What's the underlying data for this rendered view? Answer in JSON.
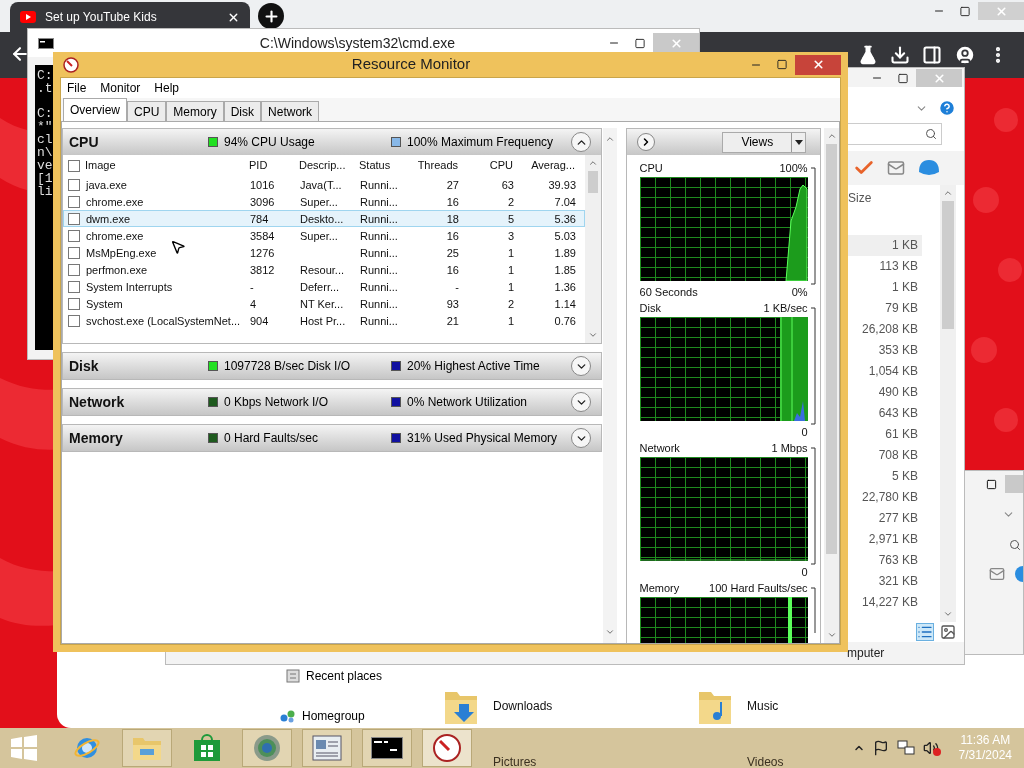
{
  "browser": {
    "tab": {
      "title": "Set up YouTube Kids"
    }
  },
  "cmd": {
    "title": "C:\\Windows\\system32\\cmd.exe",
    "blocks": [
      [
        "C:",
        ".t"
      ],
      [
        "C:",
        "*\"",
        "cl",
        "n\\",
        "ve",
        "[1",
        "li"
      ]
    ]
  },
  "resource_monitor": {
    "title": "Resource Monitor",
    "menu": [
      "File",
      "Monitor",
      "Help"
    ],
    "tabs": [
      {
        "label": "Overview",
        "selected": true
      },
      {
        "label": "CPU",
        "selected": false
      },
      {
        "label": "Memory",
        "selected": false
      },
      {
        "label": "Disk",
        "selected": false
      },
      {
        "label": "Network",
        "selected": false
      }
    ],
    "sections": [
      {
        "name": "CPU",
        "expanded": true,
        "stats": [
          {
            "text": "94% CPU Usage",
            "color": "#22e022"
          },
          {
            "text": "100% Maximum Frequency",
            "color": "#88b8e8"
          }
        ]
      },
      {
        "name": "Disk",
        "expanded": false,
        "stats": [
          {
            "text": "1097728 B/sec Disk I/O",
            "color": "#22e022"
          },
          {
            "text": "20% Highest Active Time",
            "color": "#1010a0"
          }
        ]
      },
      {
        "name": "Network",
        "expanded": false,
        "stats": [
          {
            "text": "0 Kbps Network I/O",
            "color": "#1e5a1e"
          },
          {
            "text": "0% Network Utilization",
            "color": "#1010a0"
          }
        ]
      },
      {
        "name": "Memory",
        "expanded": false,
        "stats": [
          {
            "text": "0 Hard Faults/sec",
            "color": "#1e5a1e"
          },
          {
            "text": "31% Used Physical Memory",
            "color": "#1010a0"
          }
        ]
      }
    ],
    "process_table": {
      "all_checked": false,
      "columns": [
        "Image",
        "PID",
        "Descrip...",
        "Status",
        "Threads",
        "CPU",
        "Averag..."
      ],
      "rows": [
        {
          "checked": false,
          "selected": false,
          "cells": [
            "java.exe",
            "1016",
            "Java(T...",
            "Runni...",
            "27",
            "63",
            "39.93"
          ]
        },
        {
          "checked": false,
          "selected": false,
          "cells": [
            "chrome.exe",
            "3096",
            "Super...",
            "Runni...",
            "16",
            "2",
            "7.04"
          ]
        },
        {
          "checked": false,
          "selected": true,
          "cells": [
            "dwm.exe",
            "784",
            "Deskto...",
            "Runni...",
            "18",
            "5",
            "5.36"
          ]
        },
        {
          "checked": false,
          "selected": false,
          "cells": [
            "chrome.exe",
            "3584",
            "Super...",
            "Runni...",
            "16",
            "3",
            "5.03"
          ]
        },
        {
          "checked": false,
          "selected": false,
          "cells": [
            "MsMpEng.exe",
            "1276",
            null,
            "Runni...",
            "25",
            "1",
            "1.89"
          ]
        },
        {
          "checked": false,
          "selected": false,
          "cells": [
            "perfmon.exe",
            "3812",
            "Resour...",
            "Runni...",
            "16",
            "1",
            "1.85"
          ]
        },
        {
          "checked": false,
          "selected": false,
          "cells": [
            "System Interrupts",
            "-",
            "Deferr...",
            "Runni...",
            "-",
            "1",
            "1.36"
          ]
        },
        {
          "checked": false,
          "selected": false,
          "cells": [
            "System",
            "4",
            "NT Ker...",
            "Runni...",
            "93",
            "2",
            "1.14"
          ]
        },
        {
          "checked": false,
          "selected": false,
          "cells": [
            "svchost.exe (LocalSystemNet...",
            "904",
            "Host Pr...",
            "Runni...",
            "21",
            "1",
            "0.76"
          ]
        }
      ]
    },
    "graph_panel": {
      "views_button": "Views",
      "graphs": [
        {
          "kind": "rise",
          "title": "CPU",
          "scale_max": "100%",
          "footer_left": "60 Seconds",
          "scale_min": "0%"
        },
        {
          "kind": "burst",
          "title": "Disk",
          "scale_max": "1 KB/sec",
          "scale_min": "0"
        },
        {
          "kind": "flat",
          "title": "Network",
          "scale_max": "1 Mbps",
          "scale_min": "0"
        },
        {
          "kind": "spike",
          "title": "Memory",
          "scale_max": "100 Hard Faults/sec"
        }
      ]
    }
  },
  "explorer": {
    "column": "Size",
    "sizes": [
      "1 KB",
      "113 KB",
      "1 KB",
      "79 KB",
      "26,208 KB",
      "353 KB",
      "1,054 KB",
      "490 KB",
      "643 KB",
      "61 KB",
      "708 KB",
      "5 KB",
      "22,780 KB",
      "277 KB",
      "2,971 KB",
      "763 KB",
      "321 KB",
      "14,227 KB"
    ],
    "status": "mputer"
  },
  "explorer_lower": {
    "nav": [
      {
        "label": "Recent places",
        "kind": "recent"
      },
      {
        "label": "Homegroup",
        "kind": "homegroup"
      }
    ],
    "folders": [
      {
        "label": "Downloads",
        "kind": "downloads"
      },
      {
        "label": "Music",
        "kind": "music"
      },
      {
        "label": "Pictures"
      },
      {
        "label": "Videos"
      }
    ]
  },
  "taskbar": {
    "apps": [
      {
        "kind": "ie",
        "running": false,
        "selected": false
      },
      {
        "kind": "explorer",
        "running": true,
        "selected": false
      },
      {
        "kind": "store",
        "running": false,
        "selected": false
      },
      {
        "kind": "chrome",
        "running": true,
        "selected": false
      },
      {
        "kind": "reader",
        "running": true,
        "selected": false
      },
      {
        "kind": "cmd",
        "running": true,
        "selected": false
      },
      {
        "kind": "resmon",
        "running": true,
        "selected": true
      }
    ],
    "clock": {
      "time": "11:36 AM",
      "date": "7/31/2024"
    }
  }
}
